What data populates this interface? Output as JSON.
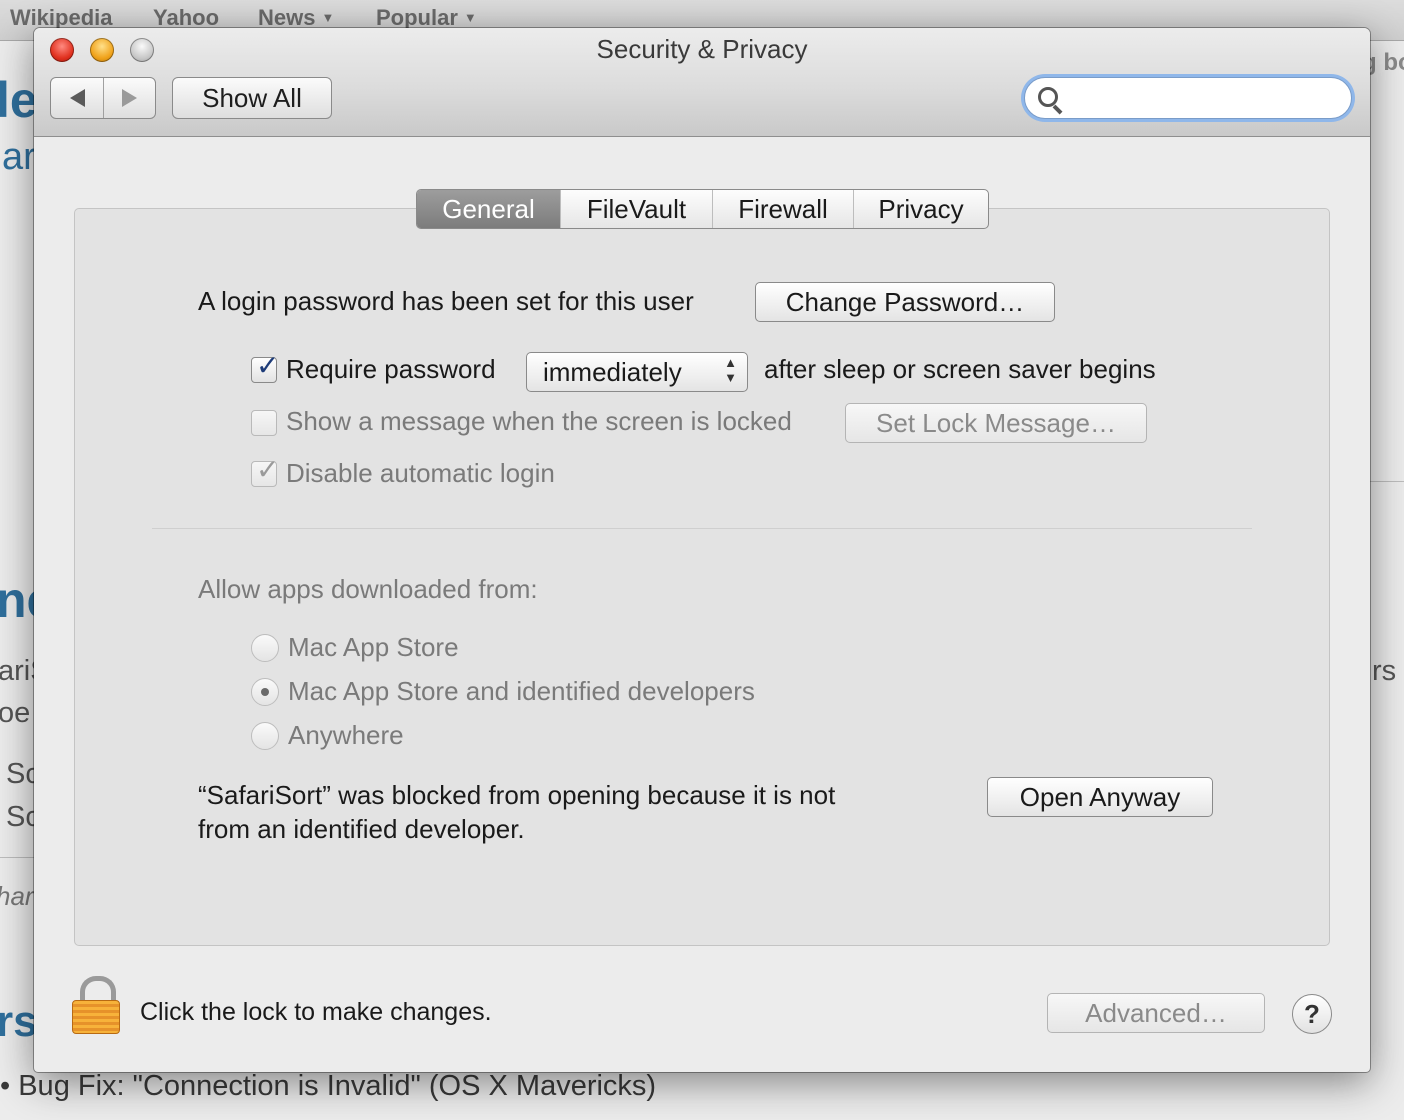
{
  "browser": {
    "bookmarks": [
      {
        "label": "Wikipedia"
      },
      {
        "label": "Yahoo"
      },
      {
        "label": "News",
        "caret": "▼"
      },
      {
        "label": "Popular",
        "caret": "▼"
      }
    ],
    "fragments": {
      "f1": "le",
      "f2": "ar",
      "f3": "g bo",
      "f4": "ne",
      "f5": "ariS",
      "f6": "oe",
      "f7": "Sc",
      "f8": "Sc",
      "f9": "har",
      "f10": "rs",
      "f11": "rs a"
    },
    "bullet_text": "Bug Fix: \"Connection is Invalid\" (OS X Mavericks)"
  },
  "window": {
    "title": "Security & Privacy",
    "toolbar": {
      "show_all_label": "Show All",
      "search_placeholder": ""
    }
  },
  "tabs": [
    {
      "label": "General",
      "active": true
    },
    {
      "label": "FileVault",
      "active": false
    },
    {
      "label": "Firewall",
      "active": false
    },
    {
      "label": "Privacy",
      "active": false
    }
  ],
  "general": {
    "login_text": "A login password has been set for this user",
    "change_password_label": "Change Password…",
    "require_password": {
      "checked": true,
      "label": "Require password"
    },
    "delay_value": "immediately",
    "after_sleep_text": "after sleep or screen saver begins",
    "show_message": {
      "checked": false,
      "label": "Show a message when the screen is locked"
    },
    "set_lock_message_label": "Set Lock Message…",
    "disable_auto_login": {
      "checked": true,
      "label": "Disable automatic login"
    },
    "allow_apps_heading": "Allow apps downloaded from:",
    "app_sources": [
      {
        "label": "Mac App Store",
        "selected": false
      },
      {
        "label": "Mac App Store and identified developers",
        "selected": true
      },
      {
        "label": "Anywhere",
        "selected": false
      }
    ],
    "blocked_line1": "“SafariSort” was blocked from opening because it is not",
    "blocked_line2": "from an identified developer.",
    "open_anyway_label": "Open Anyway"
  },
  "footer": {
    "lock_text": "Click the lock to make changes.",
    "advanced_label": "Advanced…",
    "help_label": "?"
  },
  "colors": {
    "accent_focus": "#8fb7ea",
    "active_tab": "#8a8a8a",
    "lock_orange": "#f0a030"
  }
}
